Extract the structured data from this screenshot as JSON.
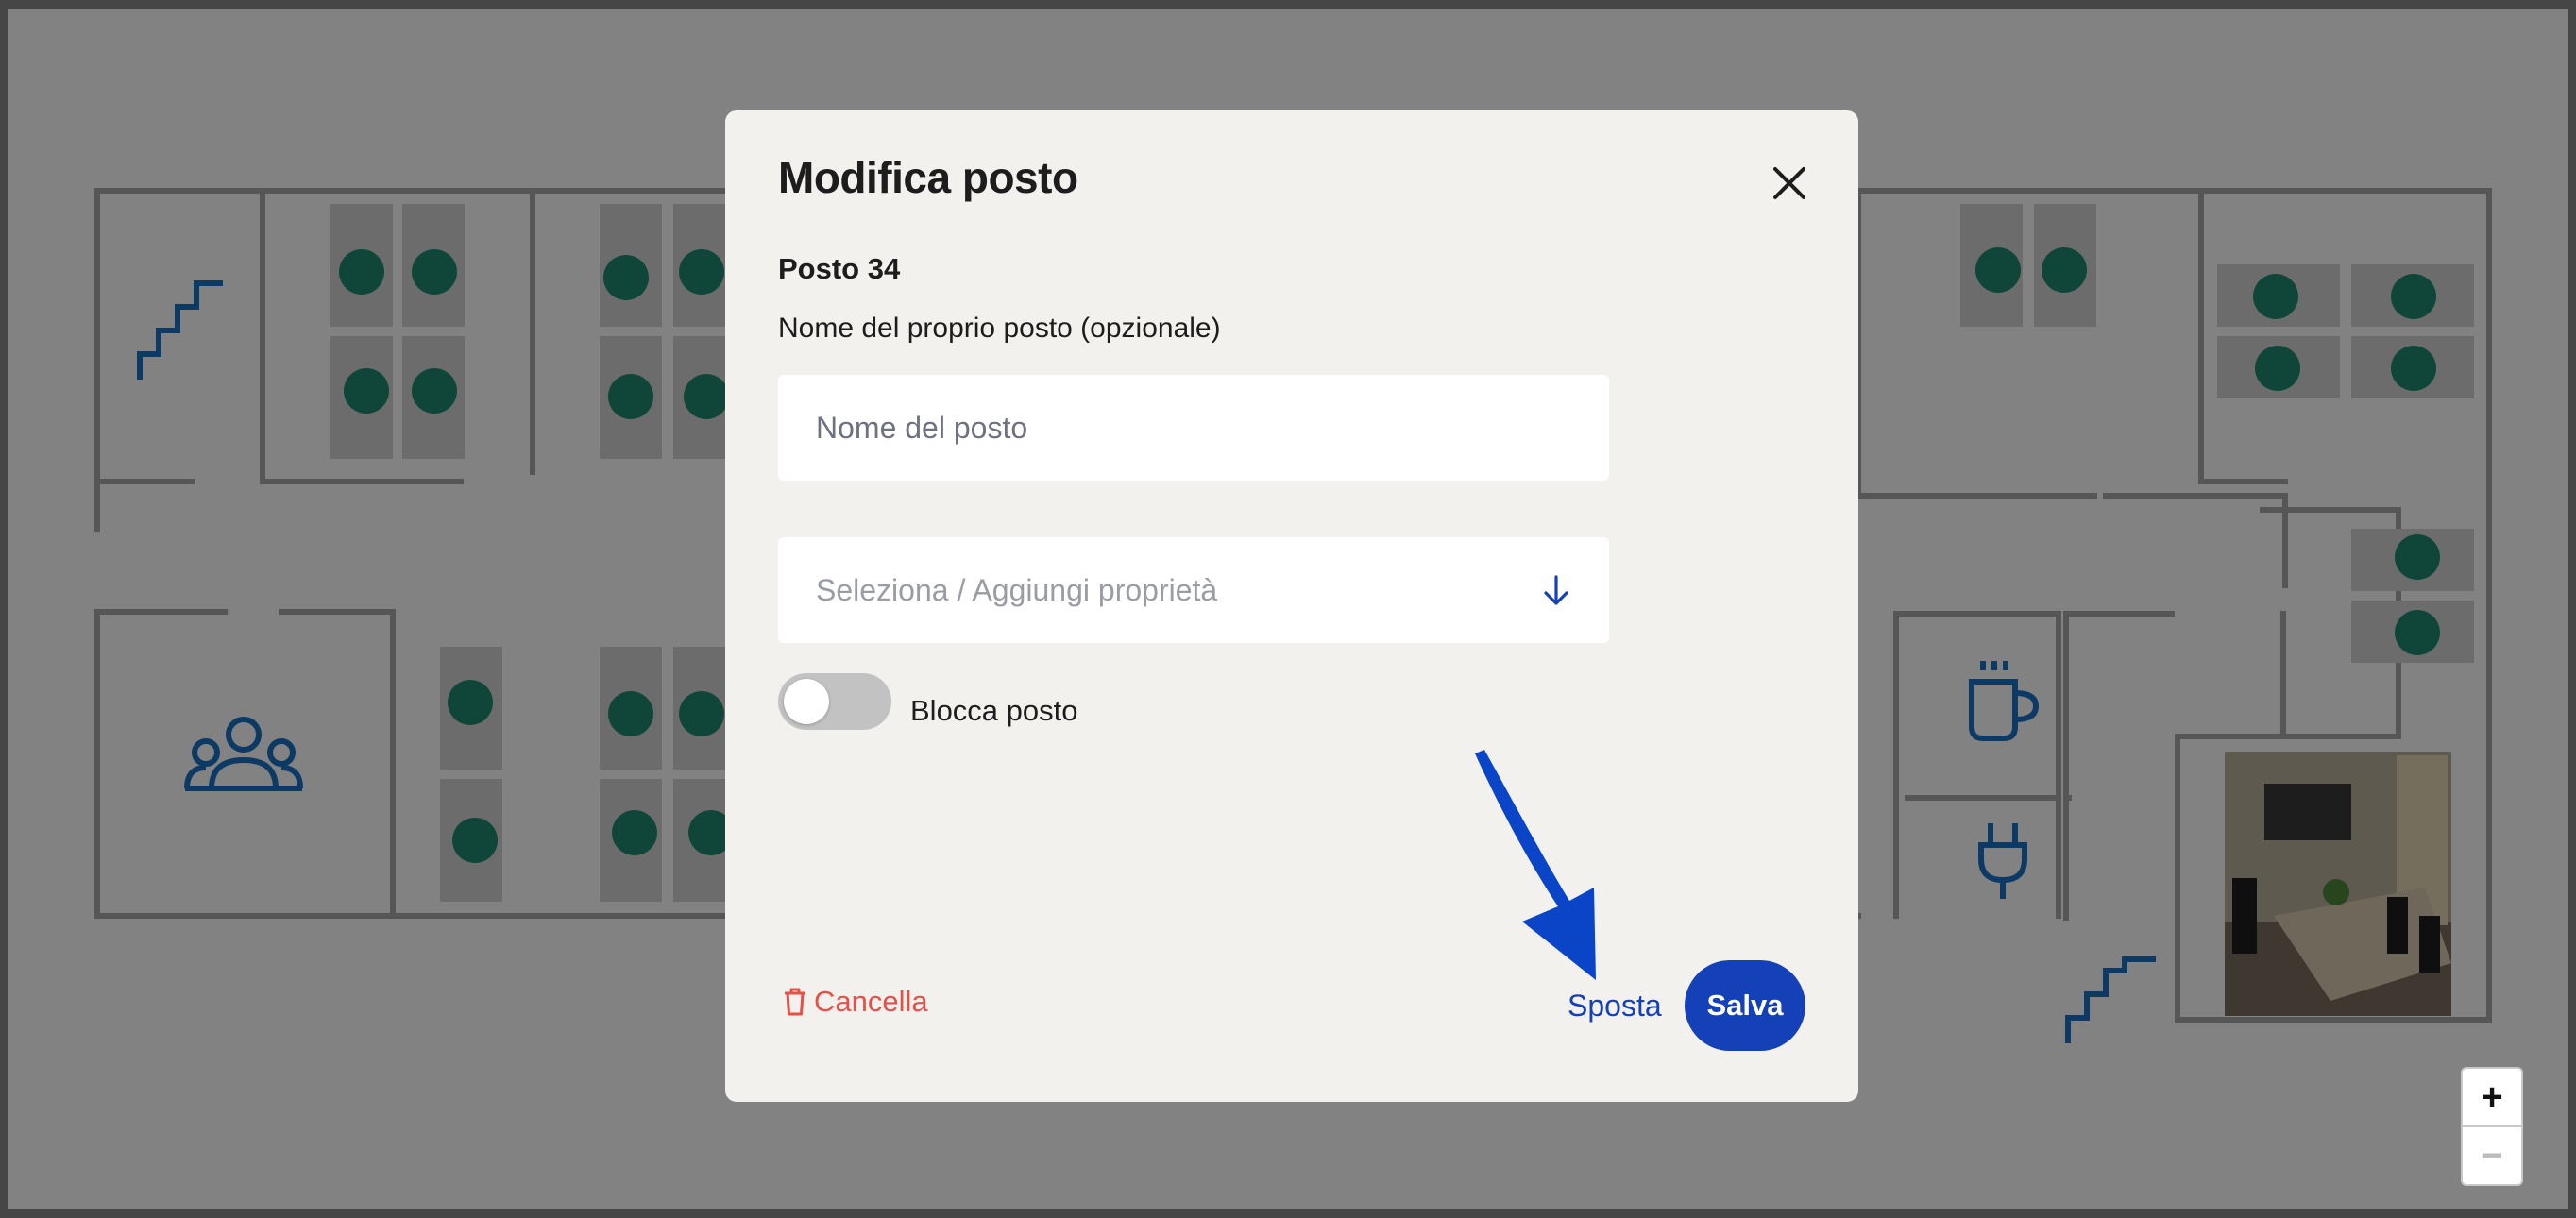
{
  "modal": {
    "title": "Modifica posto",
    "seat_label": "Posto 34",
    "name_field": {
      "label": "Nome del proprio posto (opzionale)",
      "placeholder": "Nome del posto",
      "value": ""
    },
    "properties_select": {
      "placeholder": "Seleziona / Aggiungi proprietà",
      "icon": "arrow-down-icon"
    },
    "lock_toggle": {
      "label": "Blocca posto",
      "enabled": false
    },
    "actions": {
      "delete_label": "Cancella",
      "move_label": "Sposta",
      "save_label": "Salva"
    }
  },
  "zoom": {
    "in_label": "+",
    "out_label": "−"
  },
  "colors": {
    "accent": "#1541b8",
    "danger": "#e25248",
    "seat": "#1f8a70",
    "map_icon": "#1a72c4",
    "annotation_arrow": "#0a45c8"
  }
}
